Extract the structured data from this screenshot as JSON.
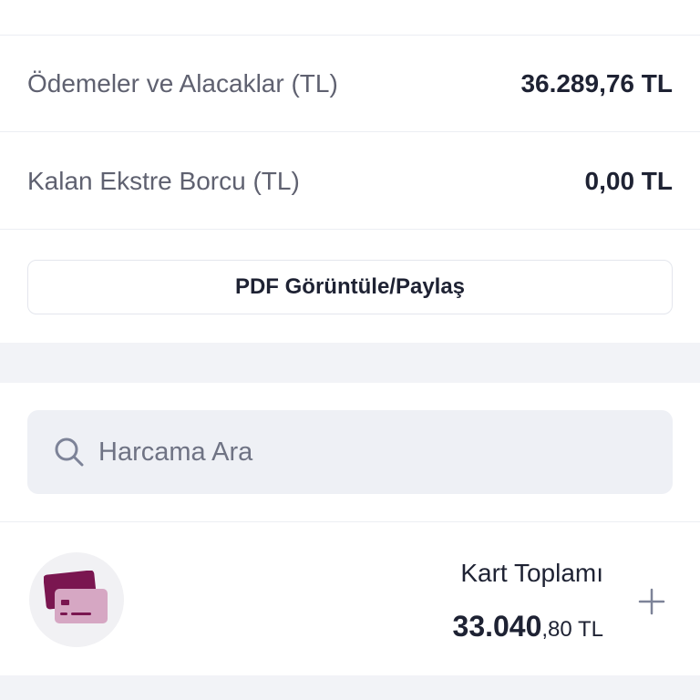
{
  "top_partial": {
    "label": ""
  },
  "summary_rows": [
    {
      "label": "Ödemeler ve Alacaklar (TL)",
      "value": "36.289,76 TL"
    },
    {
      "label": "Kalan Ekstre Borcu (TL)",
      "value": "0,00 TL"
    }
  ],
  "pdf_button": {
    "label": "PDF Görüntüle/Paylaş"
  },
  "search": {
    "placeholder": "Harcama Ara",
    "value": "",
    "icon": "search-icon"
  },
  "card_total": {
    "title": "Kart Toplamı",
    "amount_int": "33.040",
    "amount_dec": ",80 TL",
    "icon": "credit-card-icon",
    "expand_icon": "plus-icon"
  },
  "colors": {
    "card_primary": "#7a1650",
    "card_secondary": "#d6a7c3",
    "text_dark": "#1e2233",
    "text_muted": "#5f6170",
    "search_bg": "#eef0f5",
    "plus": "#7d8398"
  }
}
